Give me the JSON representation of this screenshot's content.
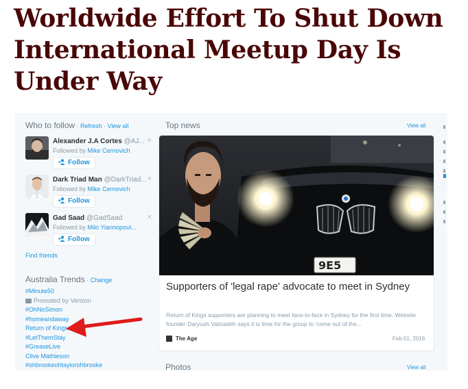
{
  "article": {
    "headline": "Worldwide Effort To Shut Down International Meetup Day Is Under Way"
  },
  "who_to_follow": {
    "title": "Who to follow",
    "sep": " · ",
    "refresh": "Refresh",
    "view_all": "View all",
    "close_glyph": "×",
    "follow_label": "Follow",
    "followed_by_prefix": "Followed by ",
    "users": [
      {
        "name": "Alexander J.A Cortes",
        "handle": "@AJ...",
        "followed_by": "Mike Cernovich"
      },
      {
        "name": "Dark Triad Man",
        "handle": "@DarkTriad...",
        "followed_by": "Mike Cernovich"
      },
      {
        "name": "Gad Saad",
        "handle": "@GadSaad",
        "followed_by": "Milo Yiannopoul..."
      }
    ],
    "find_friends": "Find friends"
  },
  "trends": {
    "title": "Australia Trends",
    "sep": " · ",
    "change": "Change",
    "items": [
      "#Minute50",
      "Promoted by Verizon",
      "#OhNoSimon",
      "#homeandaway",
      "Return of Kings",
      "#LetThemStay",
      "#GreaseLive",
      "Clive Mathieson",
      "#ohbrookeohtaylorohbrooke"
    ]
  },
  "top_news": {
    "title": "Top news",
    "view_all": "View all",
    "card": {
      "title": "Supporters of 'legal rape' advocate to meet in Sydney",
      "description": "Return of Kings supporters are planning to meet face-to-face in Sydney for the first time. Website founder Daryush Valizadeh says it is time for the group to 'come out of the...",
      "source": "The Age",
      "date": "Feb 01, 2016",
      "plate_text": "9E5"
    }
  },
  "photos": {
    "title": "Photos",
    "view_all": "View all"
  },
  "colors": {
    "headline": "#4a0707",
    "link_blue": "#1b95e0",
    "annotation_arrow": "#e01b1b"
  },
  "icons": [
    "follow-person-icon",
    "close-icon",
    "promoted-icon",
    "source-logo-icon",
    "annotation-arrow"
  ]
}
